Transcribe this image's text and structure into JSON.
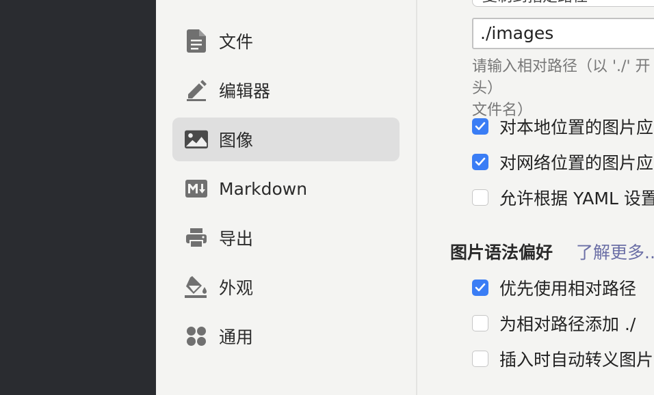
{
  "sidebar": {
    "items": [
      {
        "label": "文件",
        "icon": "file-icon"
      },
      {
        "label": "编辑器",
        "icon": "pencil-icon"
      },
      {
        "label": "图像",
        "icon": "image-icon",
        "selected": true
      },
      {
        "label": "Markdown",
        "icon": "markdown-icon"
      },
      {
        "label": "导出",
        "icon": "printer-icon"
      },
      {
        "label": "外观",
        "icon": "paint-bucket-icon"
      },
      {
        "label": "通用",
        "icon": "grid-icon"
      }
    ]
  },
  "content": {
    "copy_option_value": "复制到指定路径",
    "path_value": "./images",
    "path_hint": "请输入相对路径（以 './' 开头）\n文件名）",
    "checkboxes_top": [
      {
        "label": "对本地位置的图片应用上述规则",
        "checked": true
      },
      {
        "label": "对网络位置的图片应用上述规则",
        "checked": true
      },
      {
        "label": "允许根据 YAML 设置自动上传图片",
        "checked": false
      }
    ],
    "syntax_section": {
      "title": "图片语法偏好",
      "learn_more": "了解更多..."
    },
    "checkboxes_bottom": [
      {
        "label": "优先使用相对路径",
        "checked": true
      },
      {
        "label": "为相对路径添加 ./",
        "checked": false
      },
      {
        "label": "插入时自动转义图片URL",
        "checked": false
      }
    ]
  },
  "colors": {
    "accent": "#3a7df5",
    "link": "#6b6fa6",
    "sidebar_bg": "#f4f4f2",
    "selected_bg": "#dfdfdf",
    "dark_bg": "#2a2c30"
  }
}
